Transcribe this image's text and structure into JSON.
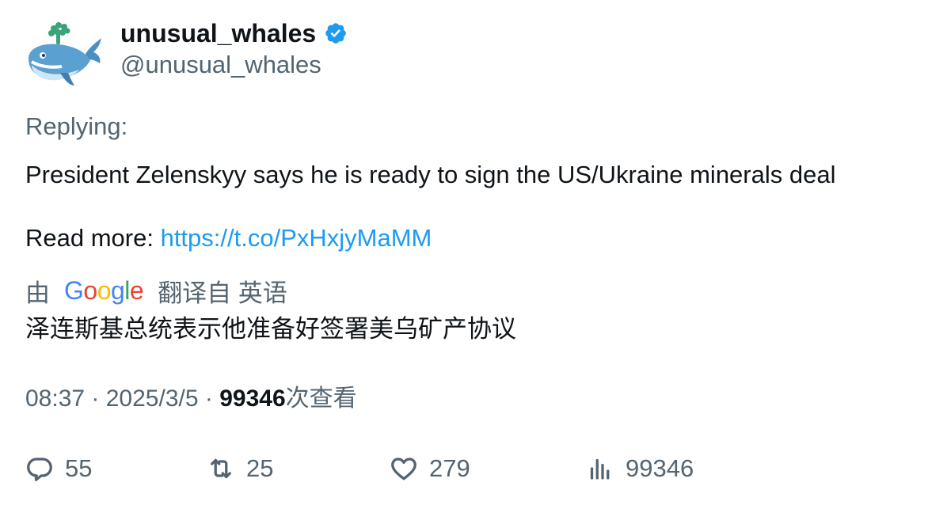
{
  "author": {
    "display_name": "unusual_whales",
    "handle": "@unusual_whales",
    "verified": true
  },
  "tweet": {
    "replying_label": "Replying:",
    "text": "President Zelenskyy says he is ready to sign the US/Ukraine minerals deal",
    "read_more_label": "Read more: ",
    "link_text": "https://t.co/PxHxjyMaMM"
  },
  "translation": {
    "prefix": "由",
    "provider": "Google",
    "suffix": "翻译自 英语",
    "text": "泽连斯基总统表示他准备好签署美乌矿产协议"
  },
  "meta": {
    "time": "08:37",
    "separator": " · ",
    "date": "2025/3/5",
    "views_count": "99346",
    "views_label": "次查看"
  },
  "actions": {
    "replies": "55",
    "retweets": "25",
    "likes": "279",
    "views": "99346"
  },
  "colors": {
    "text": "#0f1419",
    "secondary": "#536471",
    "link": "#1d9bf0",
    "verified": "#1d9bf0"
  }
}
